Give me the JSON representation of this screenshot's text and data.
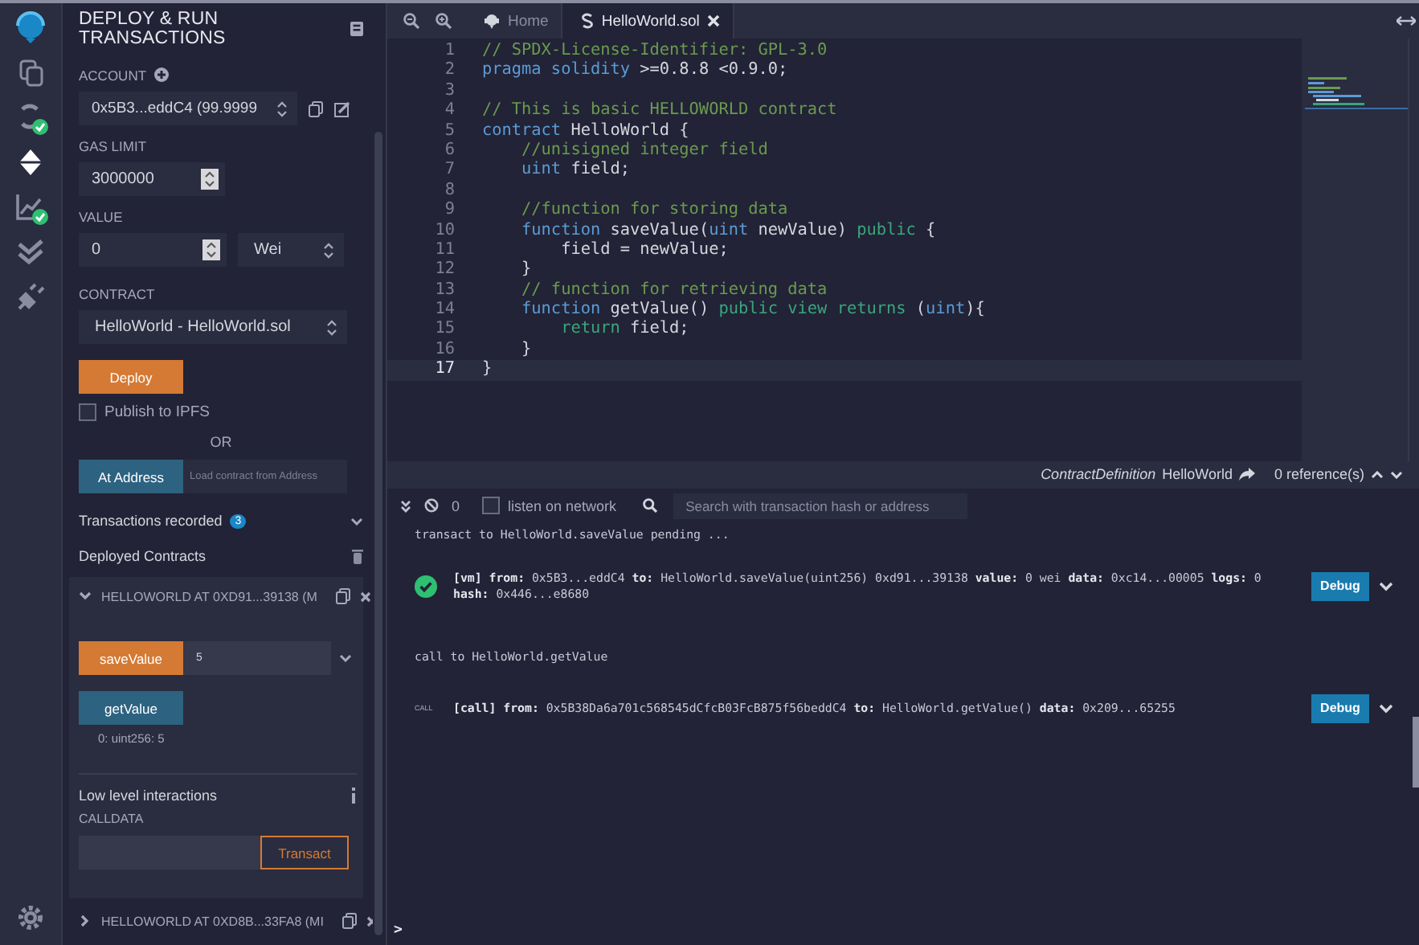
{
  "icon_bar": [
    {
      "kind": "logo",
      "selected": false,
      "checked": false
    },
    {
      "kind": "files",
      "selected": false,
      "checked": false
    },
    {
      "kind": "compiler",
      "selected": false,
      "checked": true
    },
    {
      "kind": "deploy",
      "selected": true,
      "checked": false
    },
    {
      "kind": "analysis",
      "selected": false,
      "checked": true
    },
    {
      "kind": "tests",
      "selected": false,
      "checked": false
    },
    {
      "kind": "plugins",
      "selected": false,
      "checked": false
    },
    {
      "kind": "settings",
      "selected": false,
      "checked": false
    }
  ],
  "panel": {
    "title": "DEPLOY & RUN TRANSACTIONS",
    "account": {
      "label": "ACCOUNT",
      "value": "0x5B3...eddC4 (99.9999"
    },
    "gas_limit": {
      "label": "GAS LIMIT",
      "value": "3000000"
    },
    "value": {
      "label": "VALUE",
      "value": "0",
      "unit": "Wei"
    },
    "contract": {
      "label": "CONTRACT",
      "value": "HelloWorld - HelloWorld.sol"
    },
    "deploy_button": "Deploy",
    "publish": {
      "label": "Publish to IPFS",
      "checked": false
    },
    "or_label": "OR",
    "at_address_button": "At Address",
    "address_field": {
      "placeholder": "Load contract from Address"
    },
    "transactions_recorded": {
      "label": "Transactions recorded",
      "count": "3"
    },
    "deployed_contracts": {
      "label": "Deployed Contracts"
    },
    "instances": [
      {
        "title": "HELLOWORLD AT 0XD91...39138 (M",
        "expanded": true,
        "functions": [
          {
            "kind": "transact",
            "label": "saveValue",
            "value": "5"
          },
          {
            "kind": "call",
            "label": "getValue",
            "output": "0: uint256: 5"
          }
        ],
        "low_level": {
          "title": "Low level interactions",
          "calldata_label": "CALLDATA",
          "transact_button": "Transact"
        }
      },
      {
        "title": "HELLOWORLD AT 0XD8B...33FA8 (MI",
        "expanded": false
      }
    ]
  },
  "tabs": [
    {
      "kind": "home",
      "label": "Home",
      "selected": false
    },
    {
      "kind": "file",
      "label": "HelloWorld.sol",
      "selected": true
    }
  ],
  "code": [
    {
      "number": "1",
      "current": false,
      "tokens": [
        {
          "kind": "comment",
          "text": "// SPDX-License-Identifier: GPL-3.0"
        }
      ]
    },
    {
      "number": "2",
      "current": false,
      "tokens": [
        {
          "kind": "keyword",
          "text": "pragma solidity"
        },
        {
          "kind": "plain",
          "text": " >=0.8.8 <0.9.0;"
        }
      ]
    },
    {
      "number": "3",
      "current": false
    },
    {
      "number": "4",
      "current": false,
      "tokens": [
        {
          "kind": "comment",
          "text": "// This is basic HELLOWORLD contract"
        }
      ]
    },
    {
      "number": "5",
      "current": false,
      "tokens": [
        {
          "kind": "keyword",
          "text": "contract"
        },
        {
          "kind": "plain",
          "text": " HelloWorld {"
        }
      ]
    },
    {
      "number": "6",
      "current": false,
      "tokens": [
        {
          "kind": "comment",
          "text": "    //unisigned integer field"
        }
      ]
    },
    {
      "number": "7",
      "current": false,
      "tokens": [
        {
          "kind": "keyword",
          "text": "    uint"
        },
        {
          "kind": "plain",
          "text": " field;"
        }
      ]
    },
    {
      "number": "8",
      "current": false
    },
    {
      "number": "9",
      "current": false,
      "tokens": [
        {
          "kind": "comment",
          "text": "    //function for storing data"
        }
      ]
    },
    {
      "number": "10",
      "current": false,
      "tokens": [
        {
          "kind": "keyword",
          "text": "    function"
        },
        {
          "kind": "plain",
          "text": " saveValue("
        },
        {
          "kind": "keyword",
          "text": "uint"
        },
        {
          "kind": "plain",
          "text": " newValue) "
        },
        {
          "kind": "modifier",
          "text": "public"
        },
        {
          "kind": "plain",
          "text": " {"
        }
      ]
    },
    {
      "number": "11",
      "current": false,
      "tokens": [
        {
          "kind": "plain",
          "text": "        field = newValue;"
        }
      ]
    },
    {
      "number": "12",
      "current": false,
      "tokens": [
        {
          "kind": "plain",
          "text": "    }"
        }
      ]
    },
    {
      "number": "13",
      "current": false,
      "tokens": [
        {
          "kind": "comment",
          "text": "    // function for retrieving data"
        }
      ]
    },
    {
      "number": "14",
      "current": false,
      "tokens": [
        {
          "kind": "keyword",
          "text": "    function"
        },
        {
          "kind": "plain",
          "text": " getValue() "
        },
        {
          "kind": "modifier",
          "text": "public view returns"
        },
        {
          "kind": "plain",
          "text": " ("
        },
        {
          "kind": "keyword",
          "text": "uint"
        },
        {
          "kind": "plain",
          "text": "){"
        }
      ]
    },
    {
      "number": "15",
      "current": false,
      "tokens": [
        {
          "kind": "modifier",
          "text": "        return"
        },
        {
          "kind": "plain",
          "text": " field;"
        }
      ]
    },
    {
      "number": "16",
      "current": false,
      "tokens": [
        {
          "kind": "plain",
          "text": "    }"
        }
      ]
    },
    {
      "number": "17",
      "current": true,
      "tokens": [
        {
          "kind": "plain",
          "text": "}"
        }
      ]
    }
  ],
  "definition_bar": {
    "kind_label": "ContractDefinition",
    "name": "HelloWorld",
    "references": "0 reference(s)"
  },
  "terminal": {
    "count": "0",
    "listen": {
      "label": "listen on network",
      "checked": false
    },
    "search": {
      "placeholder": "Search with transaction hash or address"
    },
    "entries": [
      {
        "kind": "text",
        "text": "transact to HelloWorld.saveValue pending ..."
      },
      {
        "kind": "tx",
        "lines": [
          "**[vm]** **from:** 0x5B3...eddC4 **to:** HelloWorld.saveValue(uint256) 0xd91...39138 **value:** 0 wei **data:** 0xc14...00005 **logs:** 0",
          "**hash:** 0x446...e8680"
        ],
        "button": "Debug"
      },
      {
        "kind": "text",
        "text": "call to HelloWorld.getValue"
      },
      {
        "kind": "call",
        "tag": "CALL",
        "lines": [
          "**[call]** **from:** 0x5B38Da6a701c568545dCfcB03FcB875f56beddC4 **to:** HelloWorld.getValue() **data:** 0x209...65255"
        ],
        "button": "Debug"
      }
    ],
    "prompt": ">"
  }
}
